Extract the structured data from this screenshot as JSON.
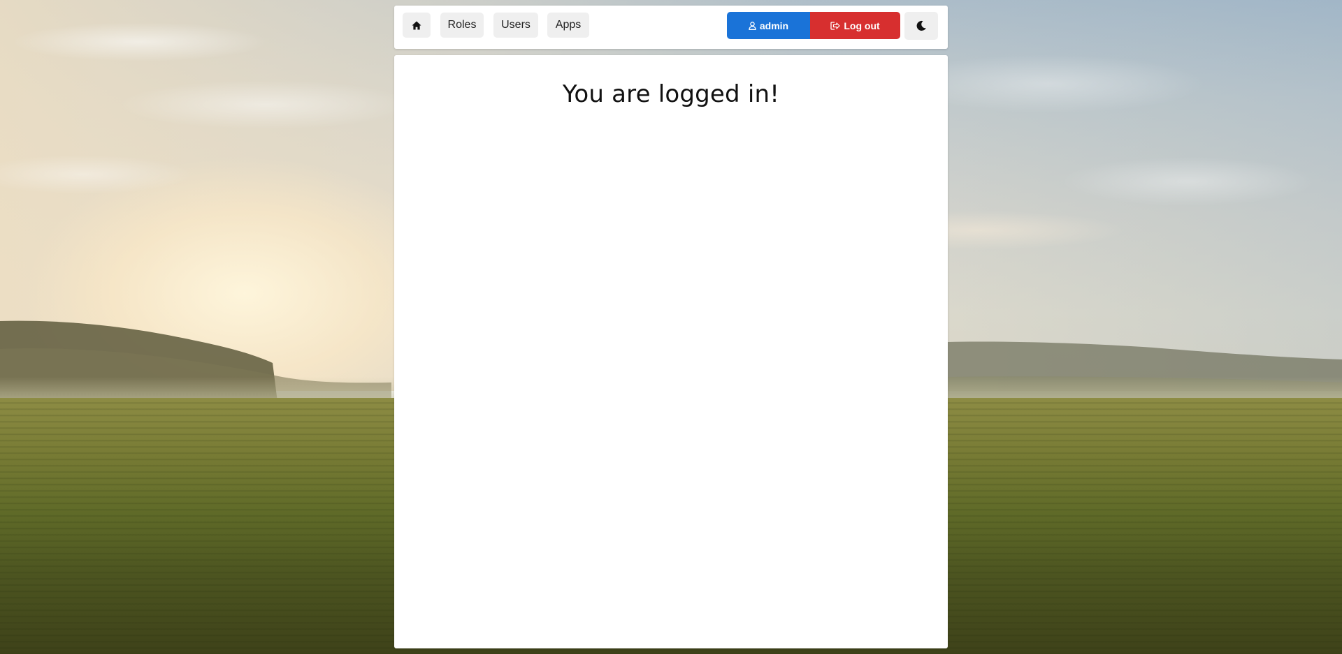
{
  "nav": {
    "home_icon": "house-icon",
    "roles_label": "Roles",
    "users_label": "Users",
    "apps_label": "Apps",
    "user_icon": "user-icon",
    "user_label": "admin",
    "logout_icon": "logout-icon",
    "logout_label": "Log out",
    "theme_icon": "moon-icon"
  },
  "main": {
    "heading": "You are logged in!"
  },
  "colors": {
    "user_button": "#1a73d8",
    "logout_button": "#d72f2f",
    "nav_button": "#efefef",
    "panel": "#ffffff"
  }
}
